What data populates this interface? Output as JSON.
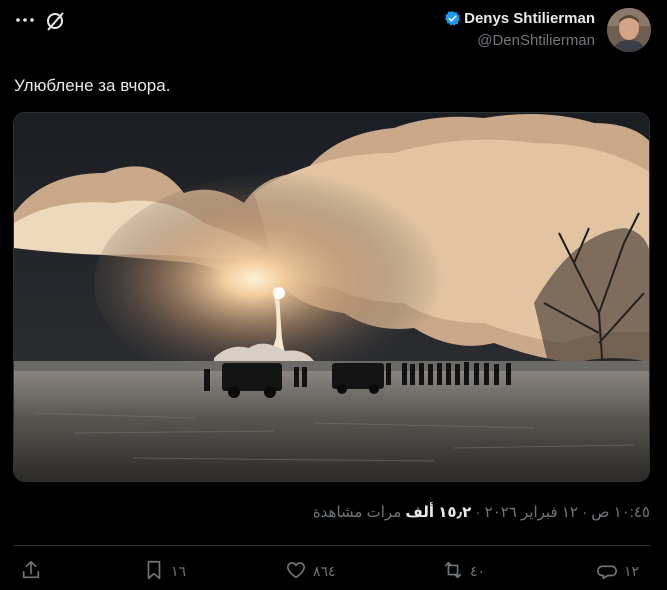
{
  "author": {
    "display_name": "Denys Shtilierman",
    "handle": "@DenShtilierman"
  },
  "tweet": {
    "text": "Улюблене за вчора."
  },
  "meta": {
    "time": "١٠:٤٥ ص",
    "date": "١٢ فبراير ٢٠٢٦",
    "views_count": "١٥٫٢ ألف",
    "views_label": "مرات مشاهدة",
    "separator": "·"
  },
  "actions": {
    "reply_count": "١٢",
    "repost_count": "٤٠",
    "like_count": "٨٦٤",
    "bookmark_count": "١٦"
  },
  "icons": [
    "more-icon",
    "grok-icon",
    "verified-badge-icon",
    "reply-icon",
    "repost-icon",
    "like-icon",
    "bookmark-icon",
    "share-icon"
  ],
  "colors": {
    "background": "#000000",
    "text": "#e7e9ea",
    "muted": "#71767b",
    "verified": "#1d9bf0",
    "border": "#2f3336"
  }
}
